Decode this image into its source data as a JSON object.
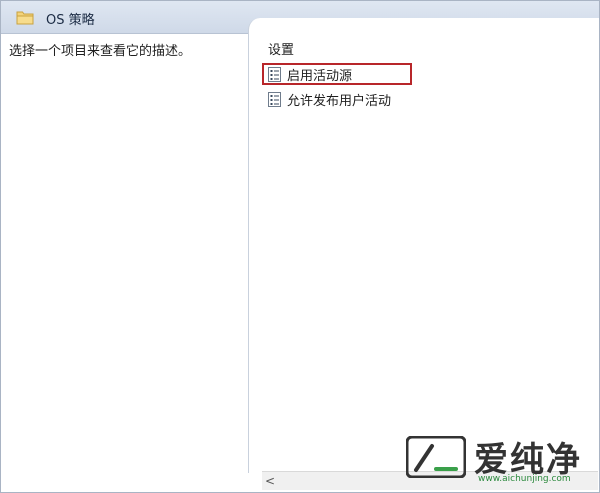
{
  "header": {
    "title": "OS 策略",
    "icon": "folder-icon"
  },
  "left_pane": {
    "description": "选择一个项目来查看它的描述。"
  },
  "settings_list": {
    "column_header": "设置",
    "items": [
      {
        "label": "启用活动源",
        "icon": "policy-setting-icon",
        "selected": true
      },
      {
        "label": "允许发布用户活动",
        "icon": "policy-setting-icon",
        "selected": false
      }
    ]
  },
  "scrollbar": {
    "left_arrow": "<"
  },
  "watermark": {
    "brand": "爱纯净",
    "url": "www.aichunjing.com"
  },
  "colors": {
    "header_bg": "#d6dfec",
    "selection_border": "#b8262a",
    "folder": "#e8c35a",
    "watermark_green": "#2c8a3e"
  }
}
